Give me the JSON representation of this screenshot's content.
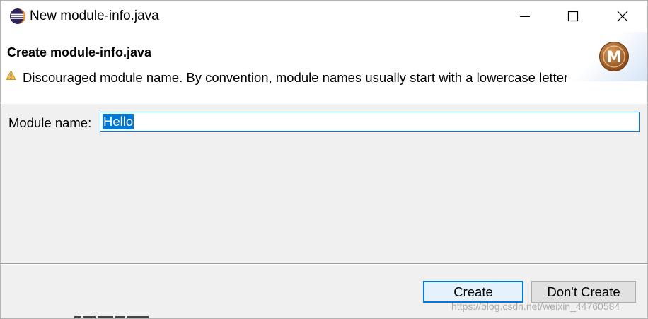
{
  "window": {
    "title": "New module-info.java",
    "buttons": [
      "minimize",
      "maximize",
      "close"
    ]
  },
  "banner": {
    "title": "Create module-info.java",
    "message": "Discouraged module name. By convention, module names usually start with a lowercase letter",
    "message_icon": "warning-icon",
    "logo_letter": "M",
    "logo_color": "#a0612a"
  },
  "form": {
    "module_name_label": "Module name:",
    "module_name_value": "Hello"
  },
  "footer": {
    "create_label": "Create",
    "dont_create_label": "Don't Create"
  },
  "watermark": "https://blog.csdn.net/weixin_44760584",
  "colors": {
    "accent": "#0078d7",
    "background": "#f0f0f0",
    "banner_background": "#ffffff"
  }
}
